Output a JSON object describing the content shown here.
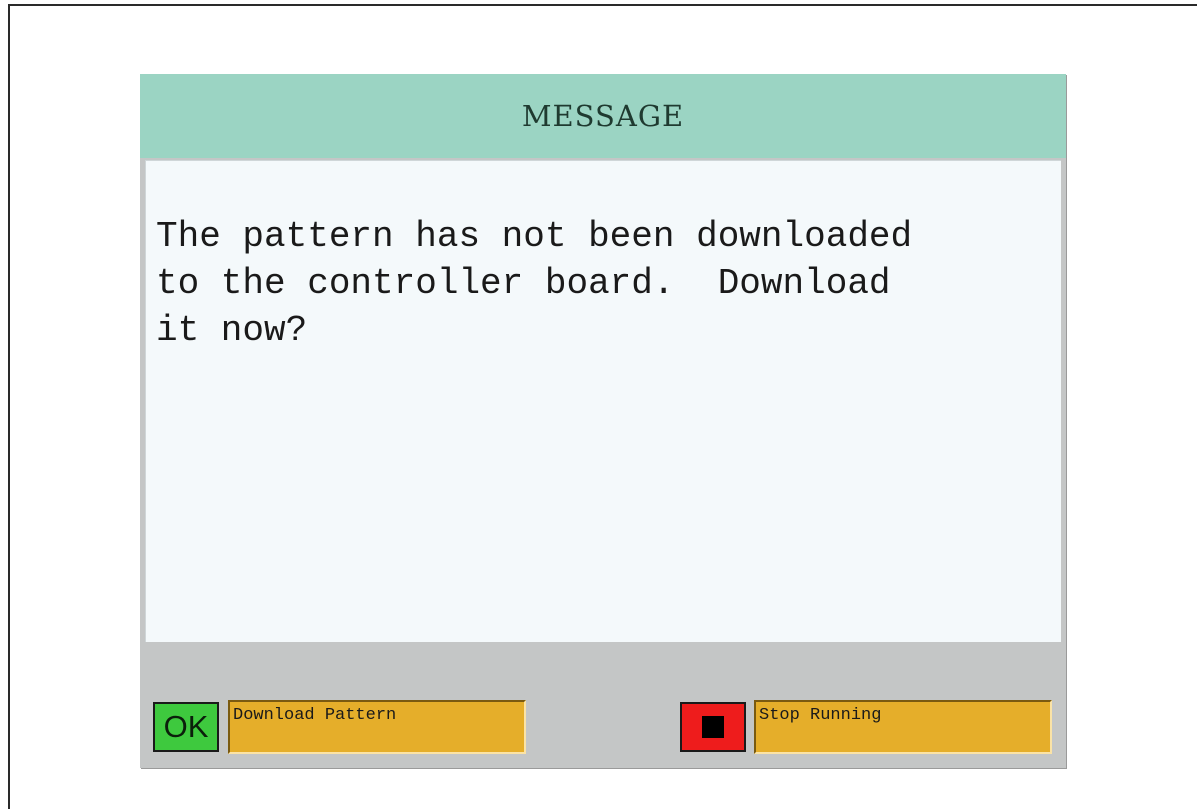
{
  "dialog": {
    "title": "MESSAGE",
    "message": "The pattern has not been downloaded\nto the controller board.  Download\nit now?"
  },
  "softkeys": {
    "ok": {
      "icon": "ok-icon",
      "icon_text": "OK",
      "label": "Download Pattern",
      "color": "#3ec93e"
    },
    "stop": {
      "icon": "stop-icon",
      "label": "Stop Running",
      "color": "#ee1c1c"
    }
  },
  "colors": {
    "title_bar": "#9bd4c3",
    "message_background": "#f4f9fb",
    "softkey_label": "#e5ae2a",
    "softkey_bar": "#c4c6c6"
  }
}
